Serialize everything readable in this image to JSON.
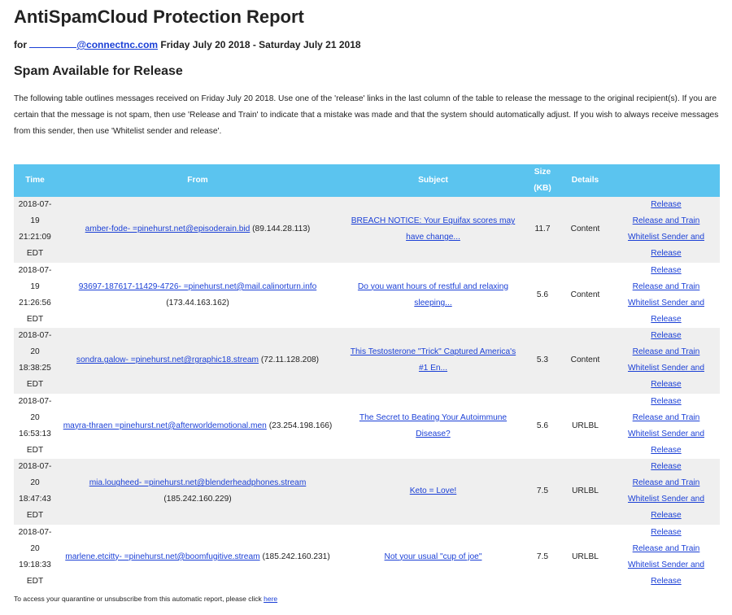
{
  "title": "AntiSpamCloud Protection Report",
  "for_label": "for",
  "email_domain": "@connectnc.com",
  "date_range": "Friday July 20 2018 - Saturday July 21 2018",
  "section_title": "Spam Available for Release",
  "intro": "The following table outlines messages received on Friday July 20 2018. Use one of the 'release' links in the last column of the table to release the message to the original recipient(s). If you are certain that the message is not spam, then use 'Release and Train' to indicate that a mistake was made and that the system should automatically adjust. If you wish to always receive messages from this sender, then use 'Whitelist sender and release'.",
  "table": {
    "headers": {
      "time": "Time",
      "from": "From",
      "subject": "Subject",
      "size": "Size (KB)",
      "details": "Details"
    },
    "action_labels": {
      "release": "Release",
      "release_train": "Release and Train",
      "whitelist": "Whitelist Sender and Release"
    },
    "rows": [
      {
        "date": "2018-07-19",
        "time": "21:21:09",
        "tz": "EDT",
        "from_addr": "amber-fode-           =pinehurst.net@episoderain.bid",
        "from_ip": "(89.144.28.113)",
        "subject": "BREACH NOTICE: Your Equifax scores may have change...",
        "size": "11.7",
        "details": "Content"
      },
      {
        "date": "2018-07-19",
        "time": "21:26:56",
        "tz": "EDT",
        "from_addr": "93697-187617-11429-4726-        =pinehurst.net@mail.calinorturn.info",
        "from_ip": "(173.44.163.162)",
        "subject": "Do you want hours of restful and relaxing sleeping...",
        "size": "5.6",
        "details": "Content"
      },
      {
        "date": "2018-07-20",
        "time": "18:38:25",
        "tz": "EDT",
        "from_addr": "sondra.galow-            =pinehurst.net@rgraphic18.stream",
        "from_ip": "(72.11.128.208)",
        "subject": "This Testosterone \"Trick\" Captured America's #1 En...",
        "size": "5.3",
        "details": "Content"
      },
      {
        "date": "2018-07-20",
        "time": "16:53:13",
        "tz": "EDT",
        "from_addr": "mayra-thraen          =pinehurst.net@afterworldemotional.men",
        "from_ip": "(23.254.198.166)",
        "subject": "The Secret to Beating Your Autoimmune Disease?",
        "size": "5.6",
        "details": "URLBL"
      },
      {
        "date": "2018-07-20",
        "time": "18:47:43",
        "tz": "EDT",
        "from_addr": "mia.lougheed-           =pinehurst.net@blenderheadphones.stream",
        "from_ip": "(185.242.160.229)",
        "subject": "Keto = Love!",
        "size": "7.5",
        "details": "URLBL"
      },
      {
        "date": "2018-07-20",
        "time": "19:18:33",
        "tz": "EDT",
        "from_addr": "marlene.etcitty-           =pinehurst.net@boomfugitive.stream",
        "from_ip": "(185.242.160.231)",
        "subject": "Not your usual \"cup of joe\"",
        "size": "7.5",
        "details": "URLBL"
      }
    ]
  },
  "footer_text": "To access your quarantine or unsubscribe from this automatic report, please click",
  "footer_link": "here",
  "colors": {
    "header_bg": "#5bc4ef",
    "link": "#1a3fd6",
    "row_alt": "#efefef"
  }
}
